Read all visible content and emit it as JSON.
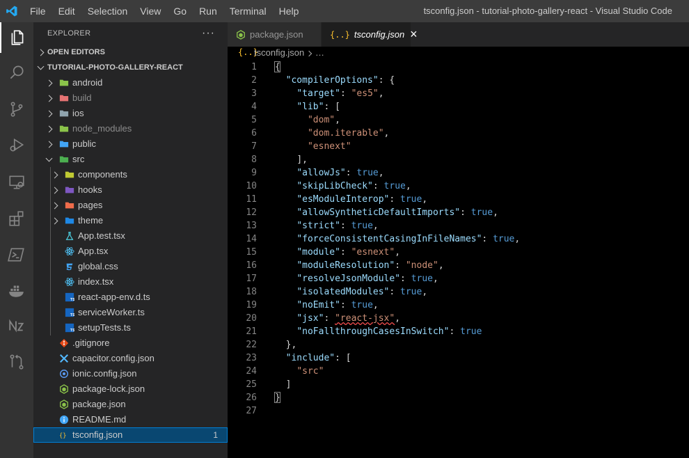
{
  "titlebar": {
    "menu": [
      "File",
      "Edit",
      "Selection",
      "View",
      "Go",
      "Run",
      "Terminal",
      "Help"
    ],
    "window_title": "tsconfig.json - tutorial-photo-gallery-react - Visual Studio Code"
  },
  "activity_bar": [
    "explorer-icon",
    "search-icon",
    "source-control-icon",
    "run-debug-icon",
    "remote-explorer-icon",
    "extensions-icon",
    "powershell-icon",
    "docker-icon",
    "nx-icon",
    "git-graph-icon"
  ],
  "sidebar": {
    "title": "EXPLORER",
    "more": "···",
    "open_editors": "OPEN EDITORS",
    "project": "TUTORIAL-PHOTO-GALLERY-REACT",
    "items": [
      {
        "label": "android",
        "depth": 1,
        "type": "folder",
        "icon_color": "#8bc34a",
        "expand": "right",
        "dim": false
      },
      {
        "label": "build",
        "depth": 1,
        "type": "folder",
        "icon_color": "#e57373",
        "expand": "right",
        "dim": true
      },
      {
        "label": "ios",
        "depth": 1,
        "type": "folder",
        "icon_color": "#90a4ae",
        "expand": "right",
        "dim": false
      },
      {
        "label": "node_modules",
        "depth": 1,
        "type": "folder",
        "icon_color": "#8bc34a",
        "expand": "right",
        "dim": true
      },
      {
        "label": "public",
        "depth": 1,
        "type": "folder",
        "icon_color": "#42a5f5",
        "expand": "right",
        "dim": false
      },
      {
        "label": "src",
        "depth": 1,
        "type": "folder",
        "icon_color": "#4caf50",
        "expand": "down",
        "dim": false
      },
      {
        "label": "components",
        "depth": 2,
        "type": "folder",
        "icon_color": "#c0ca33",
        "expand": "right",
        "dim": false
      },
      {
        "label": "hooks",
        "depth": 2,
        "type": "folder",
        "icon_color": "#7e57c2",
        "expand": "right",
        "dim": false
      },
      {
        "label": "pages",
        "depth": 2,
        "type": "folder",
        "icon_color": "#ef6c4b",
        "expand": "right",
        "dim": false
      },
      {
        "label": "theme",
        "depth": 2,
        "type": "folder",
        "icon_color": "#1e88e5",
        "expand": "right",
        "dim": false
      },
      {
        "label": "App.test.tsx",
        "depth": 2,
        "type": "file",
        "icon": "flask-icon",
        "icon_color": "#4dd0e1",
        "dim": false
      },
      {
        "label": "App.tsx",
        "depth": 2,
        "type": "file",
        "icon": "react-icon",
        "icon_color": "#4fc3f7",
        "dim": false
      },
      {
        "label": "global.css",
        "depth": 2,
        "type": "file",
        "icon": "css-icon",
        "icon_color": "#42a5f5",
        "dim": false
      },
      {
        "label": "index.tsx",
        "depth": 2,
        "type": "file",
        "icon": "react-icon",
        "icon_color": "#4fc3f7",
        "dim": false
      },
      {
        "label": "react-app-env.d.ts",
        "depth": 2,
        "type": "file",
        "icon": "typescript-icon",
        "icon_color": "#1565c0",
        "dim": false
      },
      {
        "label": "serviceWorker.ts",
        "depth": 2,
        "type": "file",
        "icon": "typescript-icon",
        "icon_color": "#1565c0",
        "dim": false
      },
      {
        "label": "setupTests.ts",
        "depth": 2,
        "type": "file",
        "icon": "typescript-icon",
        "icon_color": "#1565c0",
        "dim": false
      },
      {
        "label": ".gitignore",
        "depth": 1,
        "type": "file",
        "icon": "git-icon",
        "icon_color": "#e64a19",
        "dim": false
      },
      {
        "label": "capacitor.config.json",
        "depth": 1,
        "type": "file",
        "icon": "capacitor-icon",
        "icon_color": "#53b9ff",
        "dim": false
      },
      {
        "label": "ionic.config.json",
        "depth": 1,
        "type": "file",
        "icon": "ionic-icon",
        "icon_color": "#5b9cf5",
        "dim": false
      },
      {
        "label": "package-lock.json",
        "depth": 1,
        "type": "file",
        "icon": "nodejs-icon",
        "icon_color": "#8bc34a",
        "dim": false
      },
      {
        "label": "package.json",
        "depth": 1,
        "type": "file",
        "icon": "nodejs-icon",
        "icon_color": "#8bc34a",
        "dim": false
      },
      {
        "label": "README.md",
        "depth": 1,
        "type": "file",
        "icon": "info-icon",
        "icon_color": "#42a5f5",
        "dim": false
      },
      {
        "label": "tsconfig.json",
        "depth": 1,
        "type": "file",
        "icon": "json-icon",
        "icon_color": "#fbc02d",
        "dim": false,
        "selected": true,
        "badge": "1"
      }
    ]
  },
  "tabs": [
    {
      "label": "package.json",
      "active": false
    },
    {
      "label": "tsconfig.json",
      "active": true
    }
  ],
  "tab_close": "×",
  "breadcrumb": {
    "file": "tsconfig.json",
    "rest": "…"
  },
  "editor": {
    "line_numbers": [
      "1",
      "2",
      "3",
      "4",
      "5",
      "6",
      "7",
      "8",
      "9",
      "10",
      "11",
      "12",
      "13",
      "14",
      "15",
      "16",
      "17",
      "18",
      "19",
      "20",
      "21",
      "22",
      "23",
      "24",
      "25",
      "26",
      "27"
    ],
    "lines": [
      [
        {
          "t": "{",
          "c": "p"
        }
      ],
      [
        {
          "t": "  "
        },
        {
          "t": "\"compilerOptions\"",
          "c": "k"
        },
        {
          "t": ": {",
          "c": "p"
        }
      ],
      [
        {
          "t": "    "
        },
        {
          "t": "\"target\"",
          "c": "k"
        },
        {
          "t": ": ",
          "c": "p"
        },
        {
          "t": "\"es5\"",
          "c": "s"
        },
        {
          "t": ",",
          "c": "p"
        }
      ],
      [
        {
          "t": "    "
        },
        {
          "t": "\"lib\"",
          "c": "k"
        },
        {
          "t": ": [",
          "c": "p"
        }
      ],
      [
        {
          "t": "      "
        },
        {
          "t": "\"dom\"",
          "c": "s"
        },
        {
          "t": ",",
          "c": "p"
        }
      ],
      [
        {
          "t": "      "
        },
        {
          "t": "\"dom.iterable\"",
          "c": "s"
        },
        {
          "t": ",",
          "c": "p"
        }
      ],
      [
        {
          "t": "      "
        },
        {
          "t": "\"esnext\"",
          "c": "s"
        }
      ],
      [
        {
          "t": "    "
        },
        {
          "t": "],",
          "c": "p"
        }
      ],
      [
        {
          "t": "    "
        },
        {
          "t": "\"allowJs\"",
          "c": "k"
        },
        {
          "t": ": ",
          "c": "p"
        },
        {
          "t": "true",
          "c": "b"
        },
        {
          "t": ",",
          "c": "p"
        }
      ],
      [
        {
          "t": "    "
        },
        {
          "t": "\"skipLibCheck\"",
          "c": "k"
        },
        {
          "t": ": ",
          "c": "p"
        },
        {
          "t": "true",
          "c": "b"
        },
        {
          "t": ",",
          "c": "p"
        }
      ],
      [
        {
          "t": "    "
        },
        {
          "t": "\"esModuleInterop\"",
          "c": "k"
        },
        {
          "t": ": ",
          "c": "p"
        },
        {
          "t": "true",
          "c": "b"
        },
        {
          "t": ",",
          "c": "p"
        }
      ],
      [
        {
          "t": "    "
        },
        {
          "t": "\"allowSyntheticDefaultImports\"",
          "c": "k"
        },
        {
          "t": ": ",
          "c": "p"
        },
        {
          "t": "true",
          "c": "b"
        },
        {
          "t": ",",
          "c": "p"
        }
      ],
      [
        {
          "t": "    "
        },
        {
          "t": "\"strict\"",
          "c": "k"
        },
        {
          "t": ": ",
          "c": "p"
        },
        {
          "t": "true",
          "c": "b"
        },
        {
          "t": ",",
          "c": "p"
        }
      ],
      [
        {
          "t": "    "
        },
        {
          "t": "\"forceConsistentCasingInFileNames\"",
          "c": "k"
        },
        {
          "t": ": ",
          "c": "p"
        },
        {
          "t": "true",
          "c": "b"
        },
        {
          "t": ",",
          "c": "p"
        }
      ],
      [
        {
          "t": "    "
        },
        {
          "t": "\"module\"",
          "c": "k"
        },
        {
          "t": ": ",
          "c": "p"
        },
        {
          "t": "\"esnext\"",
          "c": "s"
        },
        {
          "t": ",",
          "c": "p"
        }
      ],
      [
        {
          "t": "    "
        },
        {
          "t": "\"moduleResolution\"",
          "c": "k"
        },
        {
          "t": ": ",
          "c": "p"
        },
        {
          "t": "\"node\"",
          "c": "s"
        },
        {
          "t": ",",
          "c": "p"
        }
      ],
      [
        {
          "t": "    "
        },
        {
          "t": "\"resolveJsonModule\"",
          "c": "k"
        },
        {
          "t": ": ",
          "c": "p"
        },
        {
          "t": "true",
          "c": "b"
        },
        {
          "t": ",",
          "c": "p"
        }
      ],
      [
        {
          "t": "    "
        },
        {
          "t": "\"isolatedModules\"",
          "c": "k"
        },
        {
          "t": ": ",
          "c": "p"
        },
        {
          "t": "true",
          "c": "b"
        },
        {
          "t": ",",
          "c": "p"
        }
      ],
      [
        {
          "t": "    "
        },
        {
          "t": "\"noEmit\"",
          "c": "k"
        },
        {
          "t": ": ",
          "c": "p"
        },
        {
          "t": "true",
          "c": "b"
        },
        {
          "t": ",",
          "c": "p"
        }
      ],
      [
        {
          "t": "    "
        },
        {
          "t": "\"jsx\"",
          "c": "k"
        },
        {
          "t": ": ",
          "c": "p"
        },
        {
          "t": "\"react-jsx\"",
          "c": "s squig"
        },
        {
          "t": ",",
          "c": "p"
        }
      ],
      [
        {
          "t": "    "
        },
        {
          "t": "\"noFallthroughCasesInSwitch\"",
          "c": "k"
        },
        {
          "t": ": ",
          "c": "p"
        },
        {
          "t": "true",
          "c": "b"
        }
      ],
      [
        {
          "t": "  "
        },
        {
          "t": "},",
          "c": "p"
        }
      ],
      [
        {
          "t": "  "
        },
        {
          "t": "\"include\"",
          "c": "k"
        },
        {
          "t": ": [",
          "c": "p"
        }
      ],
      [
        {
          "t": "    "
        },
        {
          "t": "\"src\"",
          "c": "s"
        }
      ],
      [
        {
          "t": "  "
        },
        {
          "t": "]",
          "c": "p"
        }
      ],
      [
        {
          "t": "}",
          "c": "p"
        }
      ],
      []
    ]
  }
}
